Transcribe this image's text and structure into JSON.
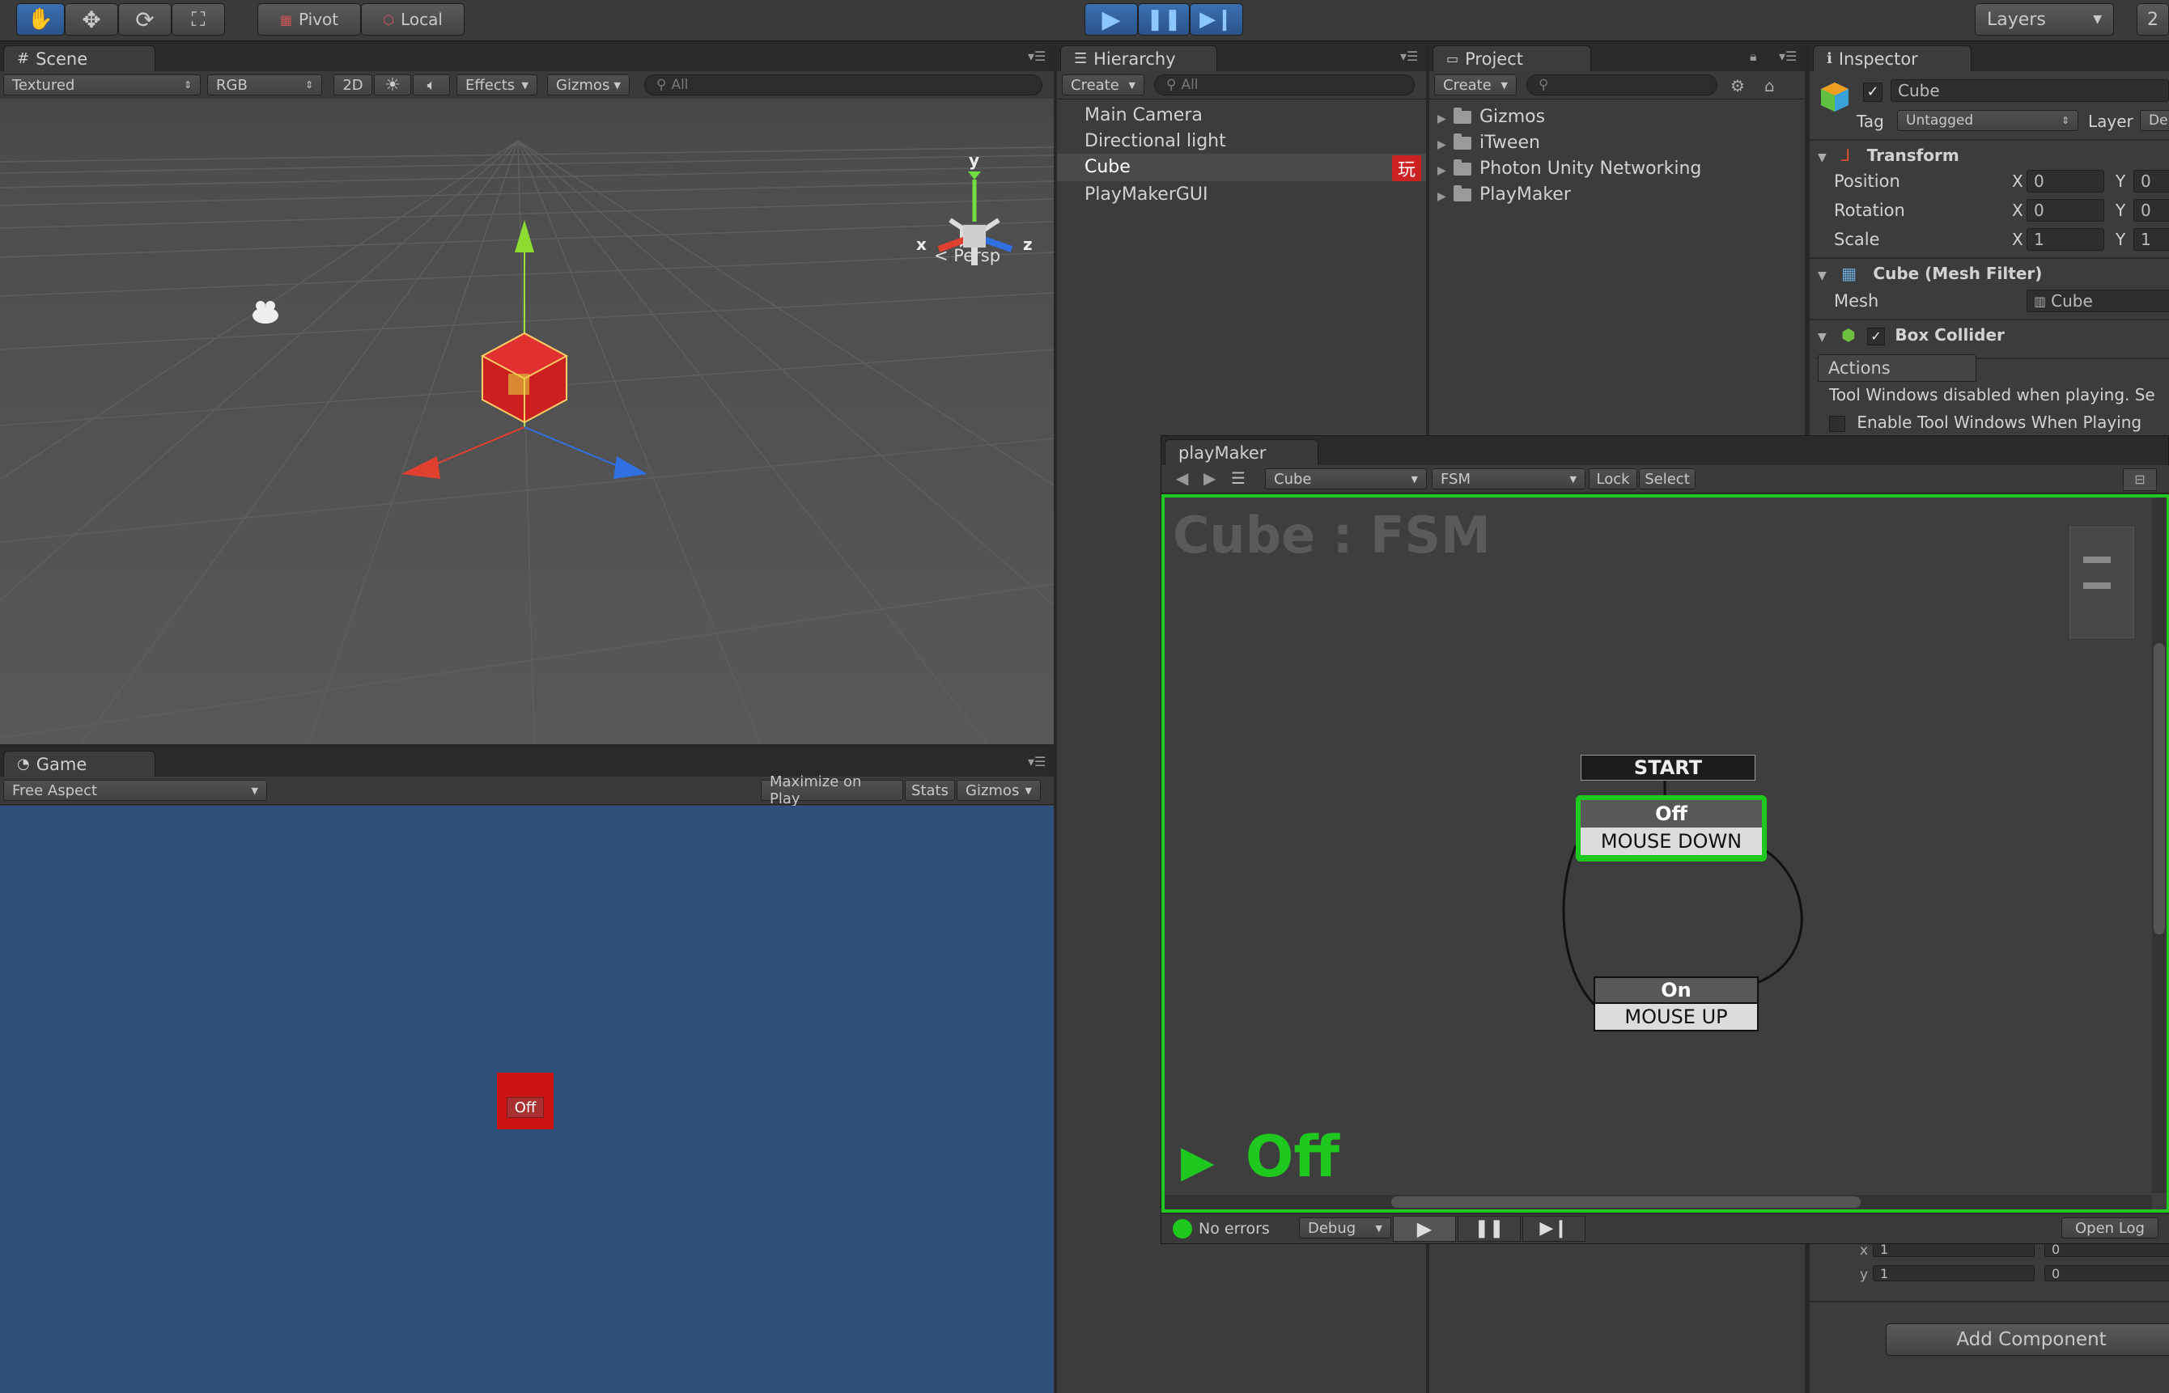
{
  "toolbar": {
    "pivot_label": "Pivot",
    "local_label": "Local",
    "layers_label": "Layers",
    "layout_label": "2"
  },
  "scene": {
    "tab_label": "Scene",
    "shading": "Textured",
    "render_mode": "RGB",
    "mode_2d": "2D",
    "effects_label": "Effects",
    "gizmos_label": "Gizmos",
    "search_placeholder": "All",
    "persp_label": "Persp",
    "axis_x": "x",
    "axis_y": "y",
    "axis_z": "z"
  },
  "game": {
    "tab_label": "Game",
    "aspect": "Free Aspect",
    "maximize_label": "Maximize on Play",
    "stats_label": "Stats",
    "gizmos_label": "Gizmos",
    "button_label": "Off"
  },
  "hierarchy": {
    "tab_label": "Hierarchy",
    "create_label": "Create",
    "search_placeholder": "All",
    "items": [
      "Main Camera",
      "Directional light",
      "Cube",
      "PlayMakerGUI"
    ],
    "badge": "玩"
  },
  "project": {
    "tab_label": "Project",
    "create_label": "Create",
    "folders": [
      "Gizmos",
      "iTween",
      "Photon Unity Networking",
      "PlayMaker"
    ]
  },
  "inspector": {
    "tab_label": "Inspector",
    "object_name": "Cube",
    "tag_label": "Tag",
    "tag_value": "Untagged",
    "layer_label": "Layer",
    "layer_value": "De",
    "transform_label": "Transform",
    "position_label": "Position",
    "rotation_label": "Rotation",
    "scale_label": "Scale",
    "x_label": "X",
    "y_label": "Y",
    "position": [
      "0",
      "0"
    ],
    "rotation": [
      "0",
      "0"
    ],
    "scale": [
      "1",
      "1"
    ],
    "mesh_filter_label": "Cube (Mesh Filter)",
    "mesh_label": "Mesh",
    "mesh_value": "Cube",
    "box_collider_label": "Box Collider",
    "actions_tab": "Actions",
    "tool_windows_msg": "Tool Windows disabled when playing. Se",
    "enable_tool_windows": "Enable Tool Windows When Playing",
    "lower_x_label": "x",
    "lower_y_label": "y",
    "lower_x_values": [
      "1",
      "0"
    ],
    "lower_y_values": [
      "1",
      "0"
    ],
    "add_component_label": "Add Component"
  },
  "playmaker": {
    "tab_label": "playMaker",
    "object_select": "Cube",
    "fsm_select": "FSM",
    "lock_label": "Lock",
    "select_label": "Select",
    "graph_title": "Cube : FSM",
    "start_label": "START",
    "state_off": "Off",
    "event_mouse_down": "MOUSE DOWN",
    "state_on": "On",
    "event_mouse_up": "MOUSE UP",
    "active_state": "Off",
    "status_text": "No errors",
    "debug_label": "Debug",
    "open_log_label": "Open Log"
  },
  "colors": {
    "accent_green": "#1ec81e",
    "game_bg": "#30507c",
    "badge_red": "#cc2222"
  }
}
